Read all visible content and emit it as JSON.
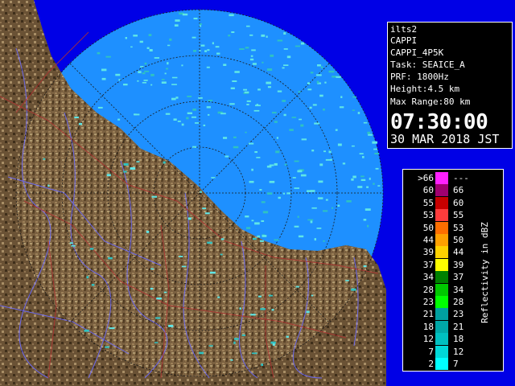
{
  "info": {
    "station": "ilts2",
    "product": "CAPPI",
    "product_code": "CAPPI_4P5K",
    "task": "Task: SEAICE_A",
    "prf": "PRF: 1800Hz",
    "height": "Height:4.5 km",
    "max_range": "Max Range:80 km",
    "time": "07:30:00",
    "date": "30 MAR 2018 JST"
  },
  "legend": {
    "unit_label": "Reflectivity in dBZ",
    "rows": [
      {
        "min": ">66",
        "max": "---",
        "color": "#ff20ff"
      },
      {
        "min": "60",
        "max": "66",
        "color": "#a00070"
      },
      {
        "min": "55",
        "max": "60",
        "color": "#c80000"
      },
      {
        "min": "53",
        "max": "55",
        "color": "#ff3c3c"
      },
      {
        "min": "50",
        "max": "53",
        "color": "#ff6e00"
      },
      {
        "min": "44",
        "max": "50",
        "color": "#ffa000"
      },
      {
        "min": "39",
        "max": "44",
        "color": "#ffd200"
      },
      {
        "min": "37",
        "max": "39",
        "color": "#ffff00"
      },
      {
        "min": "34",
        "max": "37",
        "color": "#008000"
      },
      {
        "min": "28",
        "max": "34",
        "color": "#00c800"
      },
      {
        "min": "23",
        "max": "28",
        "color": "#00ff00"
      },
      {
        "min": "21",
        "max": "23",
        "color": "#00a0a0"
      },
      {
        "min": "18",
        "max": "21",
        "color": "#00a8a8"
      },
      {
        "min": "12",
        "max": "18",
        "color": "#00c0c0"
      },
      {
        "min": "7",
        "max": "12",
        "color": "#00d8d8"
      },
      {
        "min": "2",
        "max": "7",
        "color": "#00ffff"
      }
    ]
  },
  "colors": {
    "sea_in_range": "#1e90ff",
    "sea_out_range": "#0000e6",
    "land": "#7a6040",
    "echo": "#4ad9d9",
    "rivers": "#6a6aff",
    "roads": "#b03030"
  }
}
